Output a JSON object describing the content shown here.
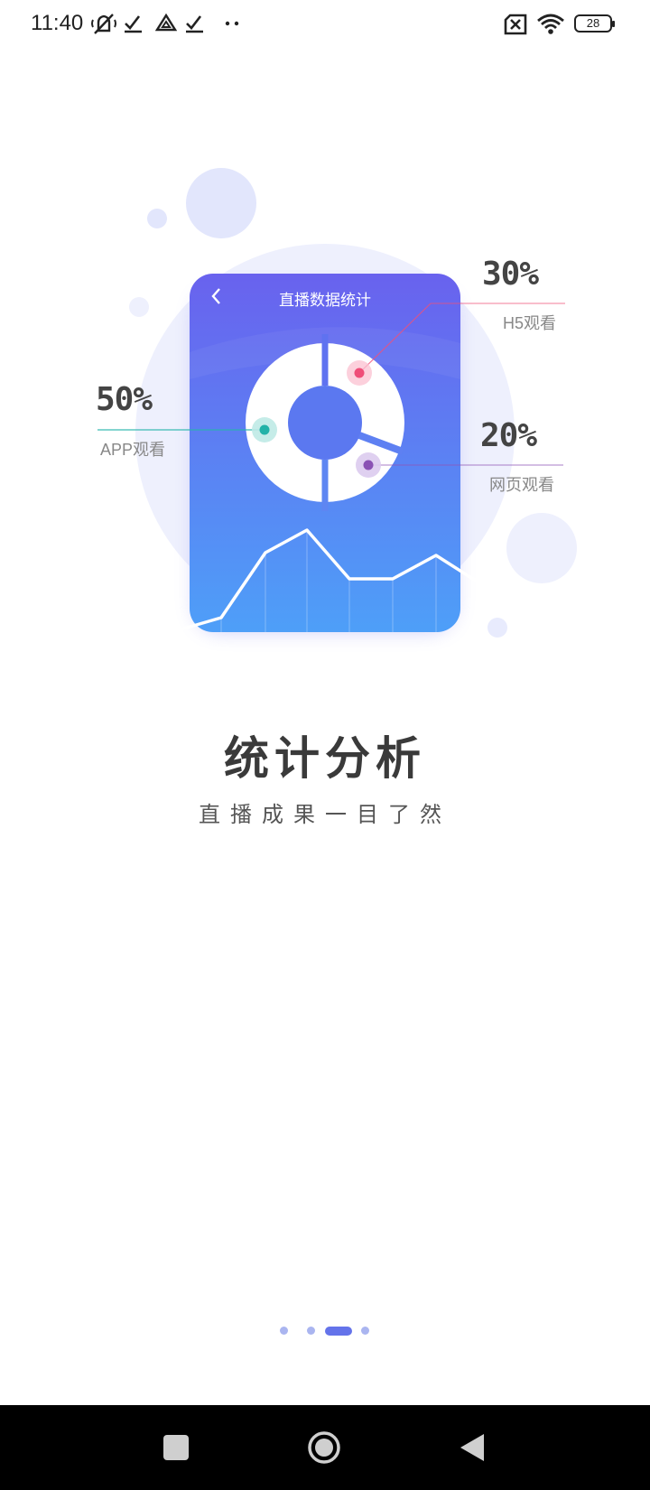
{
  "status_bar": {
    "time": "11:40",
    "icons": [
      "mute-icon",
      "check-icon",
      "drive-icon",
      "check-icon",
      "more-dots-icon",
      "no-sim-icon",
      "wifi-icon"
    ],
    "battery": "28"
  },
  "illustration": {
    "phone_title": "直播数据统计",
    "stats": [
      {
        "percent": "30%",
        "label": "H5观看",
        "color": "#f0507a"
      },
      {
        "percent": "50%",
        "label": "APP观看",
        "color": "#26b5ac"
      },
      {
        "percent": "20%",
        "label": "网页观看",
        "color": "#8e55b5"
      }
    ],
    "colors": {
      "phone_top": "#6a63ee",
      "phone_bottom": "#4fa0f8",
      "bg_circle": "#eef0fd"
    }
  },
  "intro": {
    "title": "统计分析",
    "subtitle": "直播成果一目了然"
  },
  "pager": {
    "total": 4,
    "active_index": 2
  },
  "nav": {
    "icons": [
      "recent-apps-icon",
      "home-icon",
      "back-icon"
    ]
  }
}
